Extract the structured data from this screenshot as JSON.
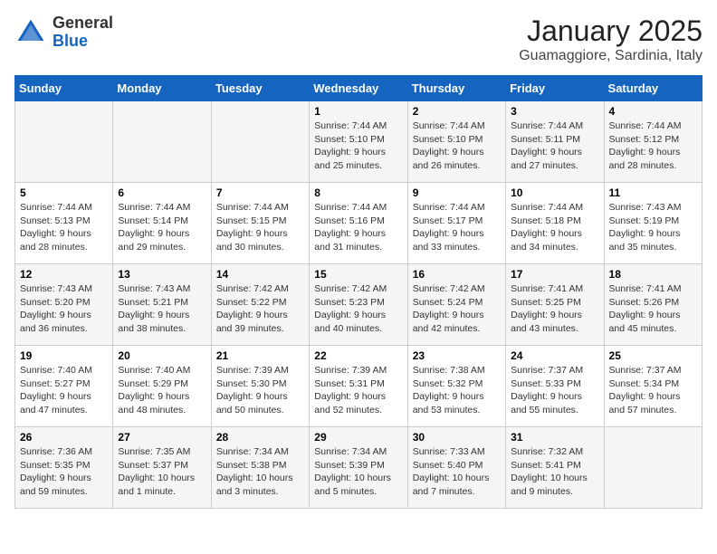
{
  "logo": {
    "general": "General",
    "blue": "Blue"
  },
  "title": "January 2025",
  "subtitle": "Guamaggiore, Sardinia, Italy",
  "days_of_week": [
    "Sunday",
    "Monday",
    "Tuesday",
    "Wednesday",
    "Thursday",
    "Friday",
    "Saturday"
  ],
  "weeks": [
    [
      {
        "num": "",
        "sunrise": "",
        "sunset": "",
        "daylight": ""
      },
      {
        "num": "",
        "sunrise": "",
        "sunset": "",
        "daylight": ""
      },
      {
        "num": "",
        "sunrise": "",
        "sunset": "",
        "daylight": ""
      },
      {
        "num": "1",
        "sunrise": "Sunrise: 7:44 AM",
        "sunset": "Sunset: 5:10 PM",
        "daylight": "Daylight: 9 hours and 25 minutes."
      },
      {
        "num": "2",
        "sunrise": "Sunrise: 7:44 AM",
        "sunset": "Sunset: 5:10 PM",
        "daylight": "Daylight: 9 hours and 26 minutes."
      },
      {
        "num": "3",
        "sunrise": "Sunrise: 7:44 AM",
        "sunset": "Sunset: 5:11 PM",
        "daylight": "Daylight: 9 hours and 27 minutes."
      },
      {
        "num": "4",
        "sunrise": "Sunrise: 7:44 AM",
        "sunset": "Sunset: 5:12 PM",
        "daylight": "Daylight: 9 hours and 28 minutes."
      }
    ],
    [
      {
        "num": "5",
        "sunrise": "Sunrise: 7:44 AM",
        "sunset": "Sunset: 5:13 PM",
        "daylight": "Daylight: 9 hours and 28 minutes."
      },
      {
        "num": "6",
        "sunrise": "Sunrise: 7:44 AM",
        "sunset": "Sunset: 5:14 PM",
        "daylight": "Daylight: 9 hours and 29 minutes."
      },
      {
        "num": "7",
        "sunrise": "Sunrise: 7:44 AM",
        "sunset": "Sunset: 5:15 PM",
        "daylight": "Daylight: 9 hours and 30 minutes."
      },
      {
        "num": "8",
        "sunrise": "Sunrise: 7:44 AM",
        "sunset": "Sunset: 5:16 PM",
        "daylight": "Daylight: 9 hours and 31 minutes."
      },
      {
        "num": "9",
        "sunrise": "Sunrise: 7:44 AM",
        "sunset": "Sunset: 5:17 PM",
        "daylight": "Daylight: 9 hours and 33 minutes."
      },
      {
        "num": "10",
        "sunrise": "Sunrise: 7:44 AM",
        "sunset": "Sunset: 5:18 PM",
        "daylight": "Daylight: 9 hours and 34 minutes."
      },
      {
        "num": "11",
        "sunrise": "Sunrise: 7:43 AM",
        "sunset": "Sunset: 5:19 PM",
        "daylight": "Daylight: 9 hours and 35 minutes."
      }
    ],
    [
      {
        "num": "12",
        "sunrise": "Sunrise: 7:43 AM",
        "sunset": "Sunset: 5:20 PM",
        "daylight": "Daylight: 9 hours and 36 minutes."
      },
      {
        "num": "13",
        "sunrise": "Sunrise: 7:43 AM",
        "sunset": "Sunset: 5:21 PM",
        "daylight": "Daylight: 9 hours and 38 minutes."
      },
      {
        "num": "14",
        "sunrise": "Sunrise: 7:42 AM",
        "sunset": "Sunset: 5:22 PM",
        "daylight": "Daylight: 9 hours and 39 minutes."
      },
      {
        "num": "15",
        "sunrise": "Sunrise: 7:42 AM",
        "sunset": "Sunset: 5:23 PM",
        "daylight": "Daylight: 9 hours and 40 minutes."
      },
      {
        "num": "16",
        "sunrise": "Sunrise: 7:42 AM",
        "sunset": "Sunset: 5:24 PM",
        "daylight": "Daylight: 9 hours and 42 minutes."
      },
      {
        "num": "17",
        "sunrise": "Sunrise: 7:41 AM",
        "sunset": "Sunset: 5:25 PM",
        "daylight": "Daylight: 9 hours and 43 minutes."
      },
      {
        "num": "18",
        "sunrise": "Sunrise: 7:41 AM",
        "sunset": "Sunset: 5:26 PM",
        "daylight": "Daylight: 9 hours and 45 minutes."
      }
    ],
    [
      {
        "num": "19",
        "sunrise": "Sunrise: 7:40 AM",
        "sunset": "Sunset: 5:27 PM",
        "daylight": "Daylight: 9 hours and 47 minutes."
      },
      {
        "num": "20",
        "sunrise": "Sunrise: 7:40 AM",
        "sunset": "Sunset: 5:29 PM",
        "daylight": "Daylight: 9 hours and 48 minutes."
      },
      {
        "num": "21",
        "sunrise": "Sunrise: 7:39 AM",
        "sunset": "Sunset: 5:30 PM",
        "daylight": "Daylight: 9 hours and 50 minutes."
      },
      {
        "num": "22",
        "sunrise": "Sunrise: 7:39 AM",
        "sunset": "Sunset: 5:31 PM",
        "daylight": "Daylight: 9 hours and 52 minutes."
      },
      {
        "num": "23",
        "sunrise": "Sunrise: 7:38 AM",
        "sunset": "Sunset: 5:32 PM",
        "daylight": "Daylight: 9 hours and 53 minutes."
      },
      {
        "num": "24",
        "sunrise": "Sunrise: 7:37 AM",
        "sunset": "Sunset: 5:33 PM",
        "daylight": "Daylight: 9 hours and 55 minutes."
      },
      {
        "num": "25",
        "sunrise": "Sunrise: 7:37 AM",
        "sunset": "Sunset: 5:34 PM",
        "daylight": "Daylight: 9 hours and 57 minutes."
      }
    ],
    [
      {
        "num": "26",
        "sunrise": "Sunrise: 7:36 AM",
        "sunset": "Sunset: 5:35 PM",
        "daylight": "Daylight: 9 hours and 59 minutes."
      },
      {
        "num": "27",
        "sunrise": "Sunrise: 7:35 AM",
        "sunset": "Sunset: 5:37 PM",
        "daylight": "Daylight: 10 hours and 1 minute."
      },
      {
        "num": "28",
        "sunrise": "Sunrise: 7:34 AM",
        "sunset": "Sunset: 5:38 PM",
        "daylight": "Daylight: 10 hours and 3 minutes."
      },
      {
        "num": "29",
        "sunrise": "Sunrise: 7:34 AM",
        "sunset": "Sunset: 5:39 PM",
        "daylight": "Daylight: 10 hours and 5 minutes."
      },
      {
        "num": "30",
        "sunrise": "Sunrise: 7:33 AM",
        "sunset": "Sunset: 5:40 PM",
        "daylight": "Daylight: 10 hours and 7 minutes."
      },
      {
        "num": "31",
        "sunrise": "Sunrise: 7:32 AM",
        "sunset": "Sunset: 5:41 PM",
        "daylight": "Daylight: 10 hours and 9 minutes."
      },
      {
        "num": "",
        "sunrise": "",
        "sunset": "",
        "daylight": ""
      }
    ]
  ]
}
